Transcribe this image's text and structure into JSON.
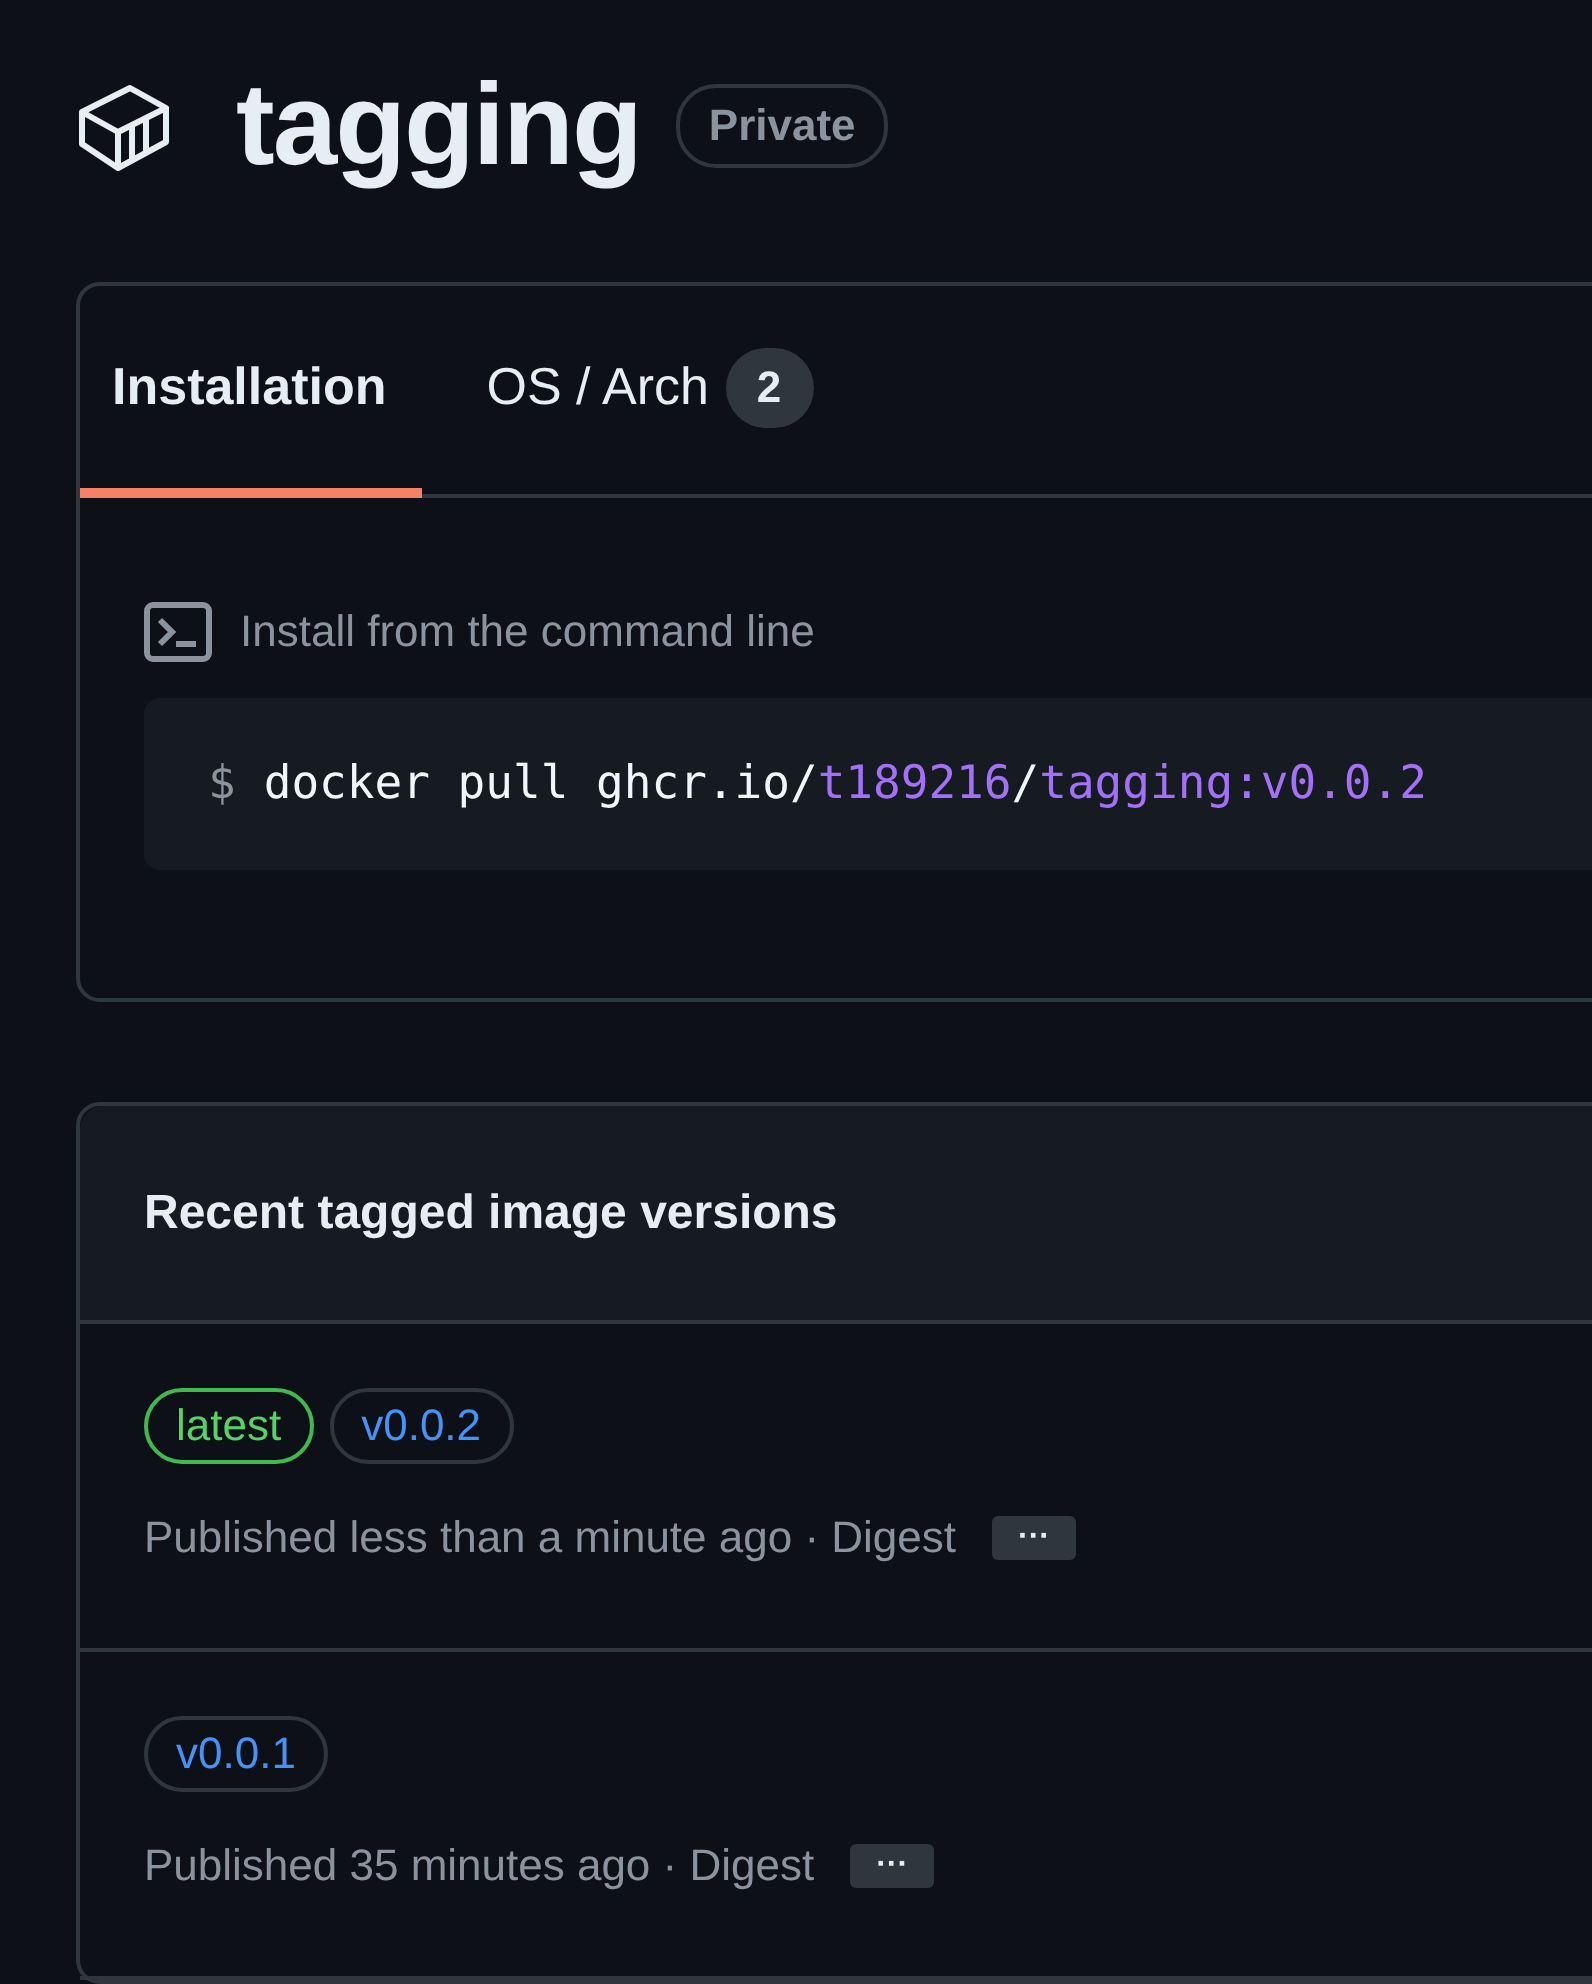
{
  "header": {
    "title": "tagging",
    "visibility": "Private"
  },
  "tabs": [
    {
      "label": "Installation",
      "selected": true
    },
    {
      "label": "OS / Arch",
      "selected": false,
      "count": "2"
    }
  ],
  "install": {
    "label": "Install from the command line",
    "prompt": "$",
    "command": [
      {
        "text": "docker pull ghcr.io/",
        "kind": "plain"
      },
      {
        "text": "t189216",
        "kind": "accent"
      },
      {
        "text": "/",
        "kind": "plain"
      },
      {
        "text": "tagging:v0.0.2",
        "kind": "accent"
      }
    ]
  },
  "versions": {
    "title": "Recent tagged image versions",
    "rows": [
      {
        "tags": [
          {
            "label": "latest",
            "kind": "latest"
          },
          {
            "label": "v0.0.2",
            "kind": "version"
          }
        ],
        "published": "Published less than a minute ago · Digest",
        "more": "···"
      },
      {
        "tags": [
          {
            "label": "v0.0.1",
            "kind": "version"
          }
        ],
        "published": "Published 35 minutes ago · Digest",
        "more": "···"
      }
    ]
  }
}
